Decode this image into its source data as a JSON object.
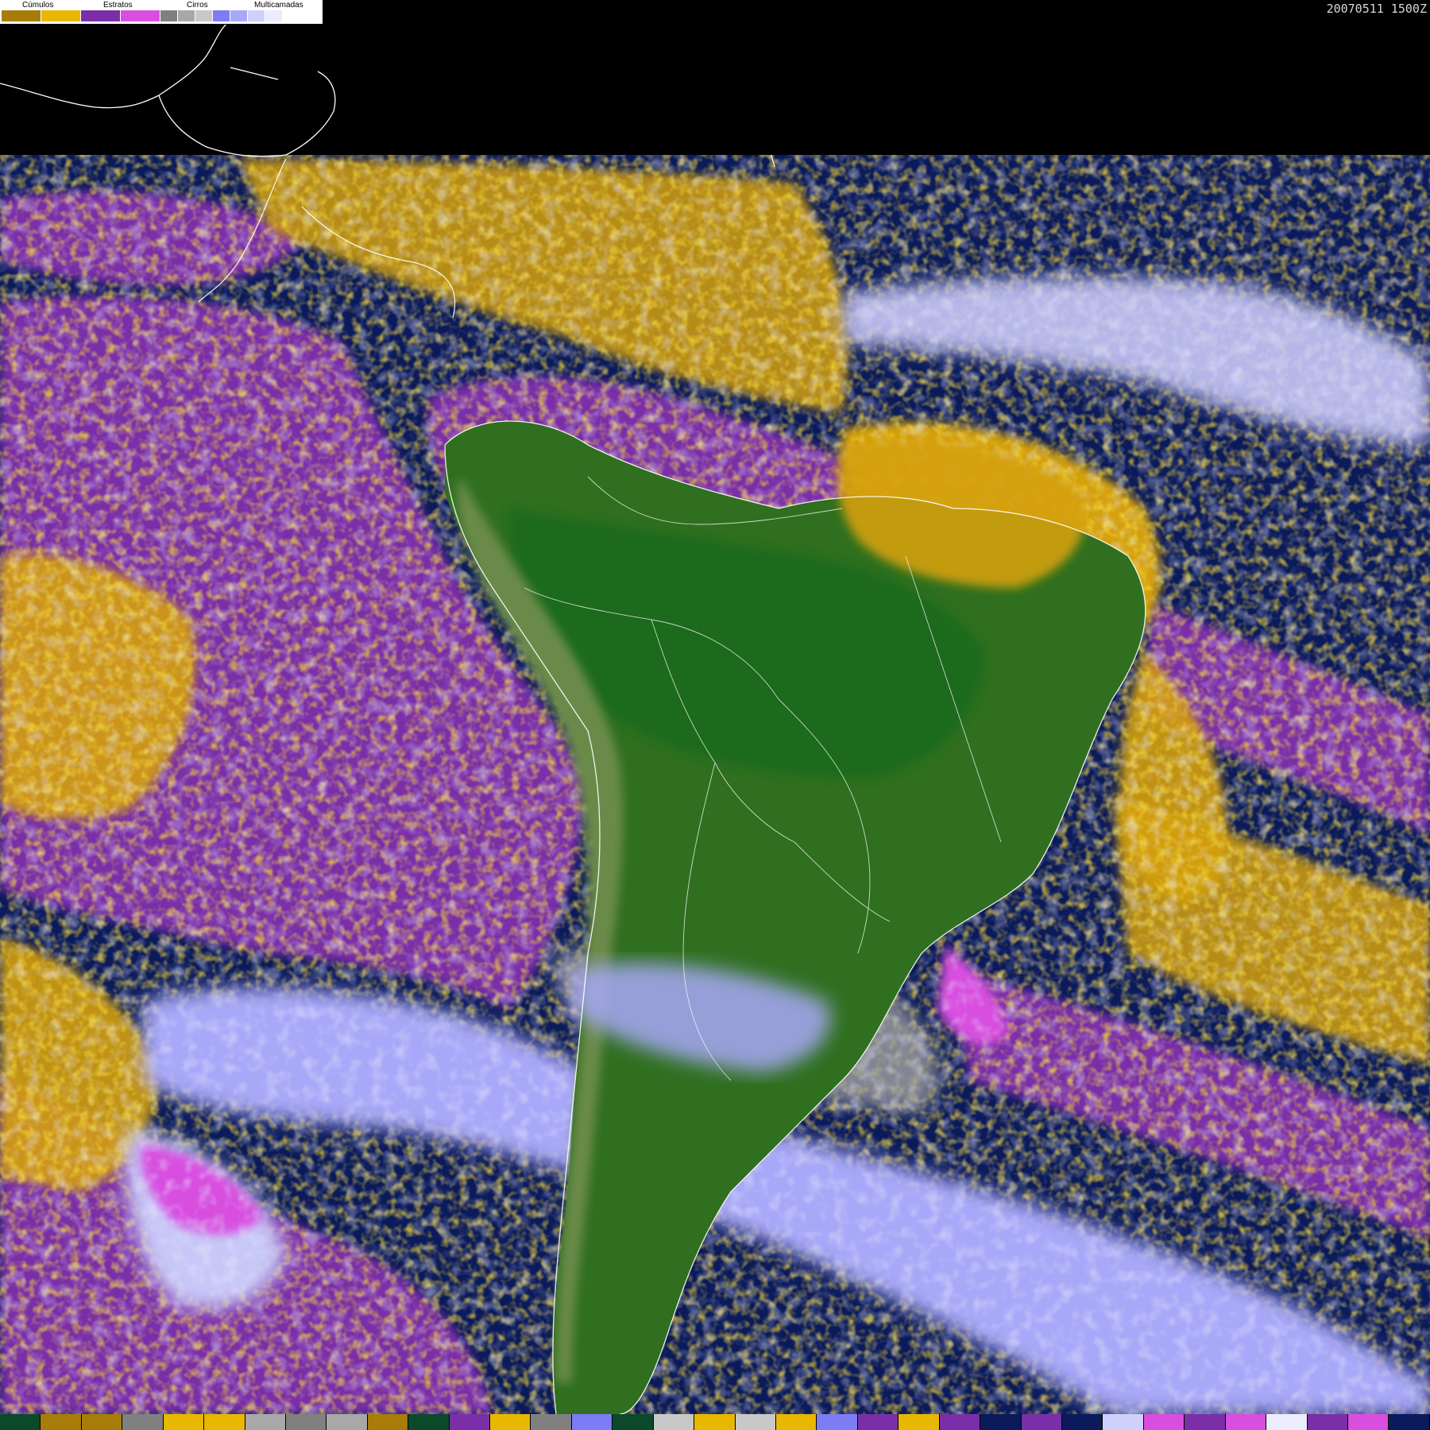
{
  "timestamp": "20070511 1500Z",
  "legend": {
    "groups": [
      {
        "label": "Cúmulos",
        "colors": [
          "#a87c08",
          "#e8b800"
        ]
      },
      {
        "label": "Estratos",
        "colors": [
          "#7a2fa8",
          "#d84fe0"
        ]
      },
      {
        "label": "Cirros",
        "colors": [
          "#808080",
          "#a8a8a8",
          "#c8c8c8"
        ]
      },
      {
        "label": "Multicamadas",
        "colors": [
          "#7c7cf4",
          "#a8a8f8",
          "#d0d0fc",
          "#ececfc"
        ]
      }
    ]
  },
  "palette": {
    "ocean": "#0a1a5a",
    "land_forest": "#1f6b1a",
    "land_savanna": "#3d7a26",
    "land_mountain": "#5a7a3a",
    "cumulus": "#d4a010",
    "stratus": "#7a2fa8",
    "stratus_bright": "#d84fe0",
    "cirrus": "#a0a0a0",
    "multilayer": "#8c8cf0",
    "multilayer_light": "#c8c8f8",
    "coastline": "#ffffff"
  },
  "colorbar": [
    "#0a4a2a",
    "#a87c08",
    "#a87c08",
    "#808080",
    "#e8b800",
    "#e8b800",
    "#a8a8a8",
    "#808080",
    "#a8a8a8",
    "#a87c08",
    "#0a4a2a",
    "#7a2fa8",
    "#e8b800",
    "#808080",
    "#7c7cf4",
    "#0a4a2a",
    "#c8c8c8",
    "#e8b800",
    "#c8c8c8",
    "#e8b800",
    "#7c7cf4",
    "#7a2fa8",
    "#e8b800",
    "#7a2fa8",
    "#0a1a5a",
    "#7a2fa8",
    "#0a1a5a",
    "#d0d0fc",
    "#d84fe0",
    "#7a2fa8",
    "#d84fe0",
    "#ececfc",
    "#7a2fa8",
    "#d84fe0",
    "#0a1a5a"
  ]
}
